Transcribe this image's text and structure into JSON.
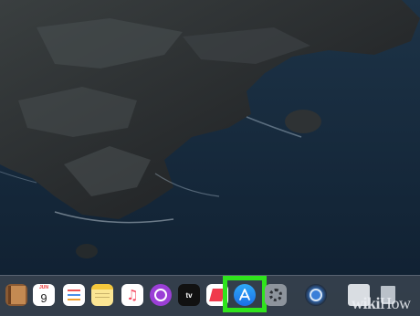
{
  "desktop": {
    "wallpaper": "Catalina coastline"
  },
  "dock": {
    "apps": [
      {
        "name": "notes-book",
        "icon": "book-icon"
      },
      {
        "name": "calendar",
        "icon": "calendar-icon",
        "month": "JUN",
        "day": "9"
      },
      {
        "name": "reminders",
        "icon": "reminders-icon"
      },
      {
        "name": "notes",
        "icon": "notes-icon"
      },
      {
        "name": "music",
        "icon": "music-icon"
      },
      {
        "name": "podcasts",
        "icon": "podcasts-icon"
      },
      {
        "name": "apple-tv",
        "icon": "apple-tv-icon",
        "label": "tv"
      },
      {
        "name": "news",
        "icon": "news-icon"
      },
      {
        "name": "app-store",
        "icon": "app-store-icon",
        "highlighted": true
      },
      {
        "name": "system-preferences",
        "icon": "gear-icon"
      },
      {
        "name": "quicktime",
        "icon": "quicktime-icon"
      },
      {
        "name": "downloads-stack",
        "icon": "stack-icon"
      },
      {
        "name": "trash",
        "icon": "trash-icon"
      }
    ],
    "highlight_color": "#2fe41c"
  },
  "watermark": {
    "bold": "wiki",
    "normal": "How"
  }
}
